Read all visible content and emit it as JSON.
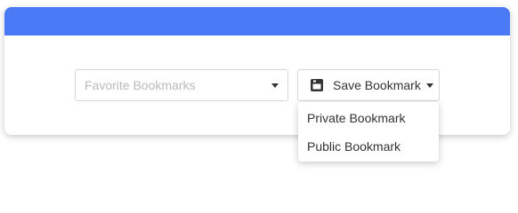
{
  "bookmarks_select": {
    "placeholder": "Favorite Bookmarks",
    "icon": "chevron-down-icon"
  },
  "save_button": {
    "label": "Save Bookmark",
    "icon": "save-icon",
    "caret_icon": "chevron-down-icon"
  },
  "save_menu": {
    "items": [
      {
        "label": "Private Bookmark"
      },
      {
        "label": "Public Bookmark"
      }
    ]
  },
  "colors": {
    "header": "#4a7af5",
    "text": "#333333",
    "placeholder": "#b9b9b9",
    "border": "#d7d7d7"
  }
}
